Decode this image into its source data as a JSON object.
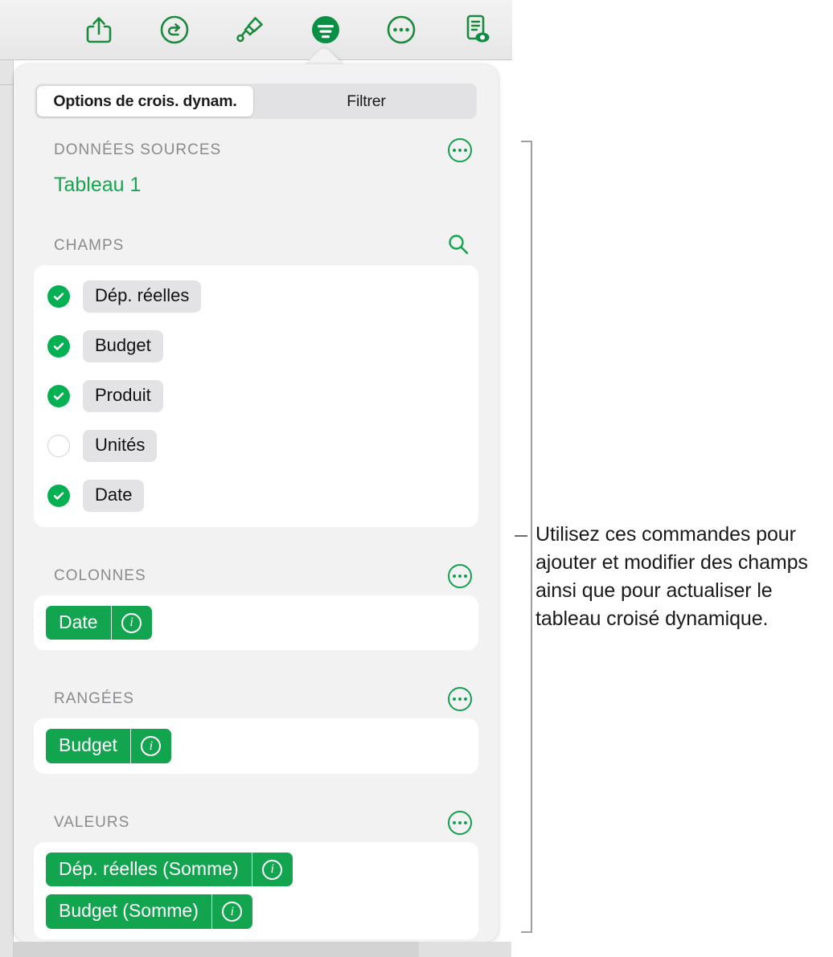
{
  "toolbar": {
    "buttons": [
      {
        "icon": "share-icon",
        "name": "share-button"
      },
      {
        "icon": "undo-icon",
        "name": "undo-button"
      },
      {
        "icon": "paintbrush-icon",
        "name": "format-paint-button"
      },
      {
        "icon": "format-filter-icon",
        "name": "format-button",
        "active": true
      },
      {
        "icon": "more-ellipsis-icon",
        "name": "more-button"
      },
      {
        "icon": "document-preview-icon",
        "name": "document-preview-button"
      }
    ]
  },
  "popover": {
    "tabs": [
      {
        "label": "Options de crois. dynam.",
        "selected": true
      },
      {
        "label": "Filtrer",
        "selected": false
      }
    ],
    "sections": {
      "source": {
        "title": "DONNÉES SOURCES",
        "value": "Tableau 1",
        "menu_icon": "more-ellipsis-icon"
      },
      "fields": {
        "title": "CHAMPS",
        "search_icon": "search-icon",
        "items": [
          {
            "label": "Dép. réelles",
            "checked": true
          },
          {
            "label": "Budget",
            "checked": true
          },
          {
            "label": "Produit",
            "checked": true
          },
          {
            "label": "Unités",
            "checked": false
          },
          {
            "label": "Date",
            "checked": true
          }
        ]
      },
      "columns": {
        "title": "COLONNES",
        "menu_icon": "more-ellipsis-icon",
        "tokens": [
          {
            "label": "Date",
            "info_icon": "info-icon"
          }
        ]
      },
      "rows": {
        "title": "RANGÉES",
        "menu_icon": "more-ellipsis-icon",
        "tokens": [
          {
            "label": "Budget",
            "info_icon": "info-icon"
          }
        ]
      },
      "values": {
        "title": "VALEURS",
        "menu_icon": "more-ellipsis-icon",
        "tokens": [
          {
            "label": "Dép. réelles (Somme)",
            "info_icon": "info-icon"
          },
          {
            "label": "Budget (Somme)",
            "info_icon": "info-icon"
          }
        ]
      }
    }
  },
  "callout": {
    "text": "Utilisez ces commandes pour ajouter et modifier des champs ainsi que pour actualiser le tableau croisé dynamique."
  },
  "colors": {
    "accent_green": "#13a450",
    "check_green": "#03b152",
    "panel_bg": "#f2f2f2",
    "chip_bg": "#e3e3e6",
    "muted_text": "#8b8b8f"
  }
}
